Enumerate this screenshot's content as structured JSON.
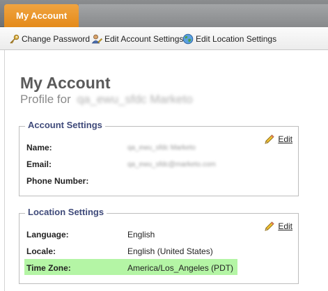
{
  "top_tabs": {
    "active_label": "My Account"
  },
  "toolbar": {
    "change_password": "Change Password",
    "edit_account_settings": "Edit Account Settings",
    "edit_location_settings": "Edit Location Settings"
  },
  "page": {
    "title": "My Account",
    "profile_prefix": "Profile for",
    "profile_name": "qa_ewu_sfdc Marketo"
  },
  "account_settings": {
    "legend": "Account Settings",
    "edit_label": "Edit",
    "rows": [
      {
        "label": "Name:",
        "value": "qa_ewu_sfdc Marketo"
      },
      {
        "label": "Email:",
        "value": "qa_ewu_sfdc@marketo.com"
      },
      {
        "label": "Phone Number:",
        "value": ""
      }
    ]
  },
  "location_settings": {
    "legend": "Location Settings",
    "edit_label": "Edit",
    "rows": [
      {
        "label": "Language:",
        "value": "English"
      },
      {
        "label": "Locale:",
        "value": "English (United States)"
      },
      {
        "label": "Time Zone:",
        "value": "America/Los_Angeles (PDT)"
      }
    ],
    "highlight_color": "#b4f5a5"
  },
  "colors": {
    "accent_orange": "#e99320",
    "legend_blue": "#3f4a7a"
  }
}
